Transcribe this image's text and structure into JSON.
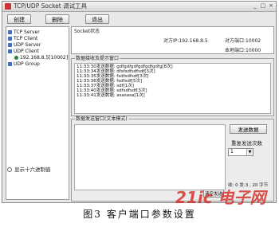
{
  "window": {
    "title": "TCP/UDP Socket 调试工具"
  },
  "toolbar": {
    "create_label": "创建",
    "delete_label": "删除",
    "exit_label": "退出"
  },
  "tree": {
    "items": [
      {
        "label": "TCP Server"
      },
      {
        "label": "TCP Client"
      },
      {
        "label": "UDP Server"
      },
      {
        "label": "UDP Client"
      },
      {
        "label": "192.168.8.5[10002]"
      },
      {
        "label": "UDP Group"
      }
    ]
  },
  "info": {
    "socket_status": "Socket状态",
    "remote_ip": "对方IP:192.168.8.5",
    "remote_port": "对方端口:10002",
    "local_port": "本地端口:10000"
  },
  "log": {
    "title": "数据接收及提示窗口",
    "lines": [
      "11:33:30发送数据: gdfgdfgdfgdfgdfgdfg[8次]",
      "11:33:34发送数据: dfsfsdfsdfsdf[3次]",
      "11:33:35发送数据: fsdfsdfsdf[3次]",
      "11:33:36发送数据: fsdfsdf[5次]",
      "11:33:37发送数据: sdf[1次]",
      "11:33:40发送数据: sdfsdfsdf[3次]",
      "11:33:41发送数据: asasasa[1次]"
    ]
  },
  "send": {
    "title": "数据发送窗口(文本模式)",
    "send_button": "发送数据",
    "repeat_label": "重复发送次数",
    "repeat_value": "1",
    "counts": "收: 0 发:3 , 20 字节",
    "clear_button": "清空发送",
    "hex_label": "显示十六进制值"
  },
  "caption": "图3  客户端口参数设置",
  "watermark": "21ic 电子网"
}
